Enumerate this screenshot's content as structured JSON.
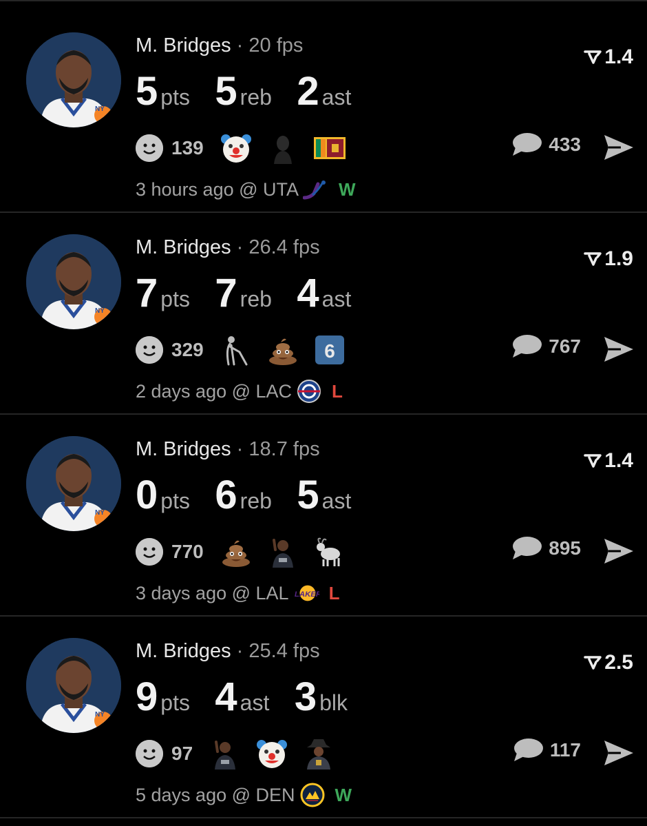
{
  "games": [
    {
      "player": "M. Bridges",
      "sep": "·",
      "fps": "20 fps",
      "rating": "1.4",
      "stats": [
        {
          "num": "5",
          "label": "pts"
        },
        {
          "num": "5",
          "label": "reb"
        },
        {
          "num": "2",
          "label": "ast"
        }
      ],
      "reaction_count": "139",
      "reaction_emojis": [
        "clown-face",
        "dark-figure",
        "sri-lanka-flag"
      ],
      "comments": "433",
      "time": "3 hours ago @ UTA",
      "opponent_logo": "jazz-logo",
      "result": "W"
    },
    {
      "player": "M. Bridges",
      "sep": "·",
      "fps": "26.4 fps",
      "rating": "1.9",
      "stats": [
        {
          "num": "7",
          "label": "pts"
        },
        {
          "num": "7",
          "label": "reb"
        },
        {
          "num": "4",
          "label": "ast"
        }
      ],
      "reaction_count": "329",
      "reaction_emojis": [
        "old-man-cane",
        "poop",
        "keycap-6"
      ],
      "keycap": "6",
      "comments": "767",
      "time": "2 days ago @ LAC",
      "opponent_logo": "clippers-logo",
      "result": "L"
    },
    {
      "player": "M. Bridges",
      "sep": "·",
      "fps": "18.7 fps",
      "rating": "1.4",
      "stats": [
        {
          "num": "0",
          "label": "pts"
        },
        {
          "num": "6",
          "label": "reb"
        },
        {
          "num": "5",
          "label": "ast"
        }
      ],
      "reaction_count": "770",
      "reaction_emojis": [
        "poop",
        "player-photo",
        "goat"
      ],
      "comments": "895",
      "time": "3 days ago @ LAL",
      "opponent_logo": "lakers-logo",
      "result": "L"
    },
    {
      "player": "M. Bridges",
      "sep": "·",
      "fps": "25.4 fps",
      "rating": "2.5",
      "stats": [
        {
          "num": "9",
          "label": "pts"
        },
        {
          "num": "4",
          "label": "ast"
        },
        {
          "num": "3",
          "label": "blk"
        }
      ],
      "reaction_count": "97",
      "reaction_emojis": [
        "player-photo",
        "clown-face",
        "cowboy-figure"
      ],
      "comments": "117",
      "time": "5 days ago @ DEN",
      "opponent_logo": "nuggets-logo",
      "result": "W"
    }
  ],
  "colors": {
    "background": "#000000",
    "win": "#3ea85a",
    "loss": "#e0483d",
    "avatar_bg": "#1f3a5f"
  }
}
